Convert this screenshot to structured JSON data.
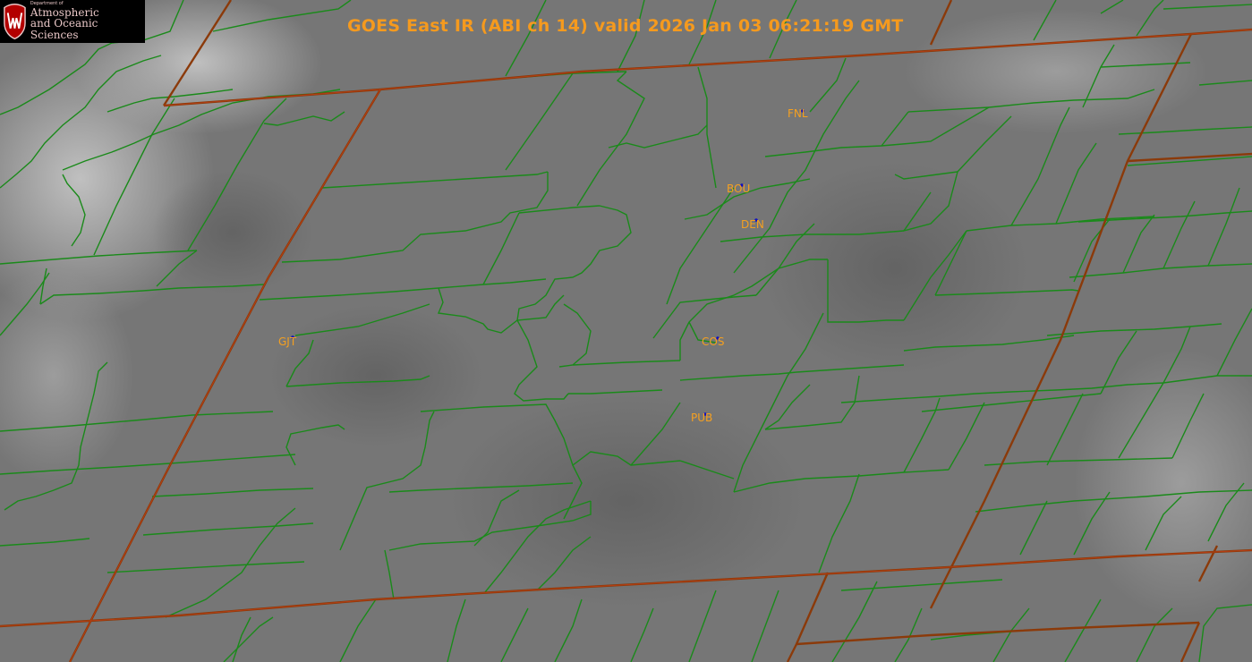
{
  "header": {
    "title": "GOES East IR (ABI ch 14) valid 2026 Jan 03 06:21:19 GMT"
  },
  "logo": {
    "department": "Department of",
    "line1": "Atmospheric",
    "line2": "and Oceanic Sciences"
  },
  "stations": [
    {
      "code": "FNL"
    },
    {
      "code": "BOU"
    },
    {
      "code": "DEN"
    },
    {
      "code": "GJT"
    },
    {
      "code": "COS"
    },
    {
      "code": "PUB"
    }
  ],
  "colors": {
    "background": "#777777",
    "county_lines": "#1a8a1a",
    "state_lines": "#8b3a0a",
    "title": "#f59a1e",
    "station_labels": "#f5a020",
    "station_marker": "#1010c0"
  }
}
